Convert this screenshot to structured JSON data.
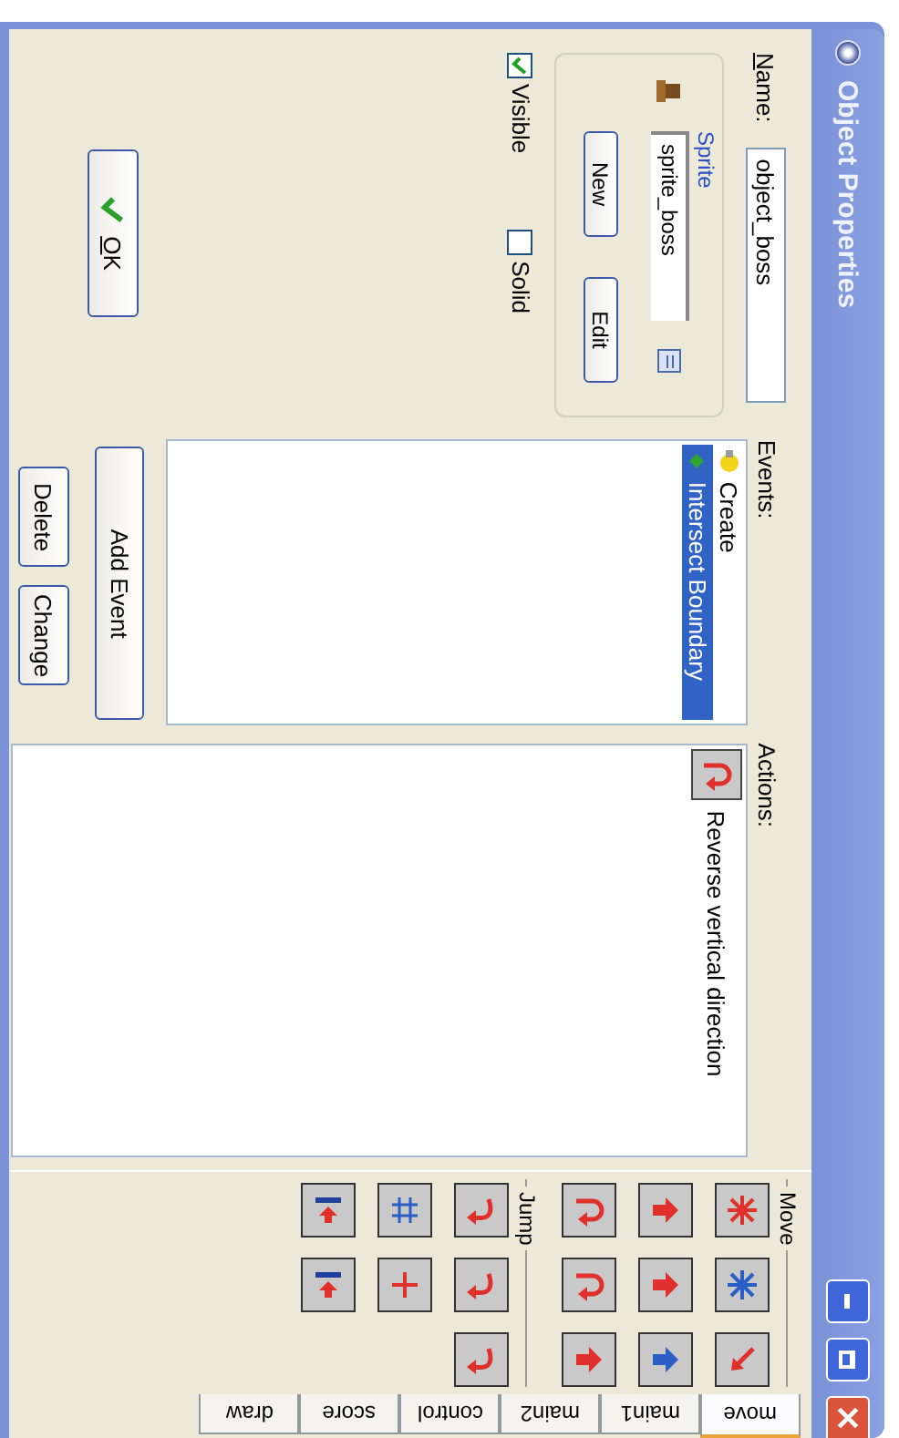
{
  "window": {
    "title": "Object Properties"
  },
  "name": {
    "label": "Name:",
    "value": "object_boss"
  },
  "sprite": {
    "legend": "Sprite",
    "value": "sprite_boss",
    "buttons": [
      "New",
      "Edit"
    ]
  },
  "checkboxes": [
    {
      "label": "Visible",
      "checked": true
    },
    {
      "label": "Solid",
      "checked": false
    }
  ],
  "ok_button": "OK",
  "events": {
    "label": "Events:",
    "items": [
      {
        "label": "Create",
        "kind": "bulb",
        "selected": false
      },
      {
        "label": "Intersect Boundary",
        "kind": "diamond",
        "selected": true
      }
    ],
    "add_button": "Add Event",
    "buttons": [
      "Delete",
      "Change"
    ]
  },
  "actions": {
    "label": "Actions:",
    "items": [
      {
        "label": "Reverse vertical direction",
        "kind": "uturn"
      }
    ]
  },
  "palette": {
    "groups": [
      {
        "label": "Move",
        "rows": [
          [
            {
              "kind": "star",
              "color": "#e0302c"
            },
            {
              "kind": "star",
              "color": "#2a5ec4"
            },
            {
              "kind": "diag",
              "color": "#e0302c"
            }
          ],
          [
            {
              "kind": "arrow",
              "color": "#e0302c"
            },
            {
              "kind": "arrow",
              "color": "#e0302c"
            },
            {
              "kind": "arrow",
              "color": "#2a5ec4"
            }
          ],
          [
            {
              "kind": "uturn",
              "color": "#e0302c"
            },
            {
              "kind": "uturn",
              "color": "#e0302c"
            },
            {
              "kind": "arrow",
              "color": "#e0302c"
            }
          ]
        ]
      },
      {
        "label": "Jump",
        "rows": [
          [
            {
              "kind": "curve",
              "color": "#e0302c"
            },
            {
              "kind": "curve",
              "color": "#e0302c"
            },
            {
              "kind": "curve",
              "color": "#e0302c"
            }
          ],
          [
            {
              "kind": "grid",
              "color": "#2a5ec4"
            },
            {
              "kind": "cross",
              "color": "#e0302c"
            }
          ],
          [
            {
              "kind": "bar",
              "color": "#e0302c"
            },
            {
              "kind": "bar",
              "color": "#e0302c"
            }
          ]
        ]
      }
    ]
  },
  "tabs": [
    {
      "label": "move",
      "selected": true
    },
    {
      "label": "main1",
      "selected": false
    },
    {
      "label": "main2",
      "selected": false
    },
    {
      "label": "control",
      "selected": false
    },
    {
      "label": "score",
      "selected": false
    },
    {
      "label": "draw",
      "selected": false
    }
  ]
}
